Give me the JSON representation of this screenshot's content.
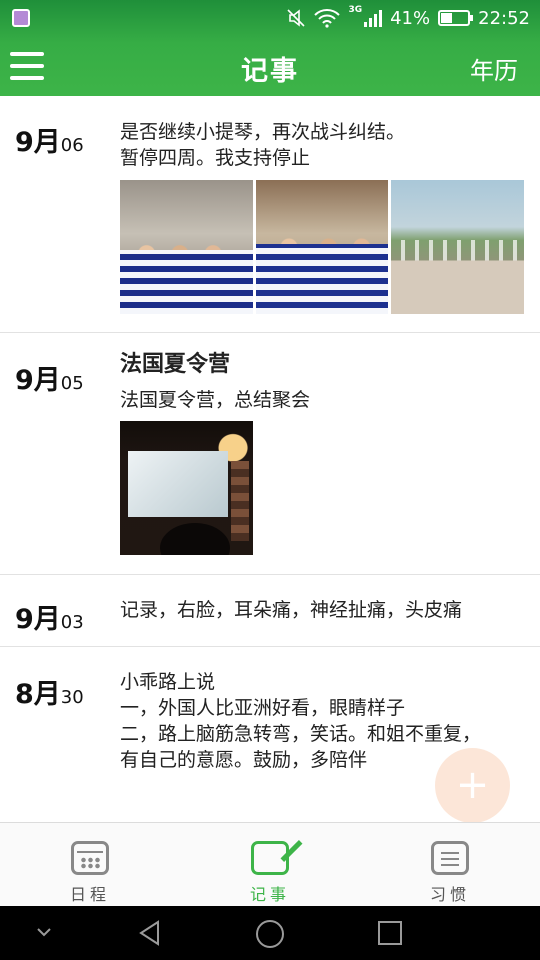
{
  "status_bar": {
    "network": "3G",
    "battery_percent": "41%",
    "battery_level": 0.41,
    "time": "22:52"
  },
  "app_bar": {
    "title": "记事",
    "calendar_link": "年历"
  },
  "entries": [
    {
      "month": "9月",
      "day": "06",
      "title": "",
      "lines": [
        "是否继续小提琴，再次战斗纠结。",
        "暂停四周。我支持停止"
      ],
      "photos": 3
    },
    {
      "month": "9月",
      "day": "05",
      "title": "法国夏令营",
      "lines": [
        "法国夏令营，总结聚会"
      ],
      "photos": 1
    },
    {
      "month": "9月",
      "day": "03",
      "title": "",
      "lines": [
        "记录，右脸，耳朵痛，神经扯痛，头皮痛"
      ],
      "photos": 0
    },
    {
      "month": "8月",
      "day": "30",
      "title": "",
      "lines": [
        "小乖路上说",
        "一，外国人比亚洲好看，眼睛样子",
        "二，路上脑筋急转弯，笑话。和姐不重复，",
        "有自己的意愿。鼓励，多陪伴"
      ],
      "photos": 0
    }
  ],
  "fab": {
    "icon": "plus-icon"
  },
  "tabs": [
    {
      "label": "日程",
      "icon": "calendar-icon",
      "active": false
    },
    {
      "label": "记事",
      "icon": "note-edit-icon",
      "active": true
    },
    {
      "label": "习惯",
      "icon": "list-icon",
      "active": false
    }
  ],
  "colors": {
    "accent": "#3db448",
    "fab": "#fbd6be"
  }
}
